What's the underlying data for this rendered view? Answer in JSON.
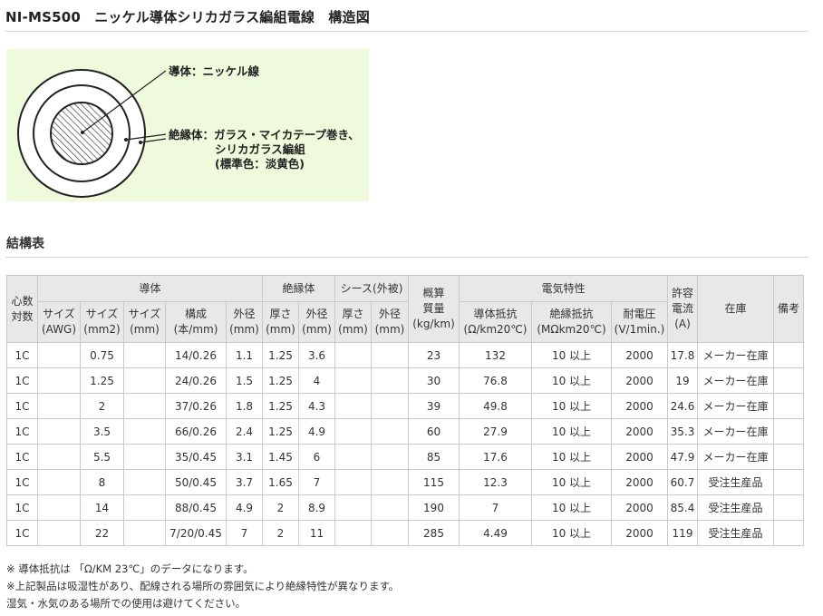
{
  "page": {
    "title": "NI-MS500　ニッケル導体シリカガラス編組電線　構造図",
    "section_title": "結構表"
  },
  "diagram": {
    "conductor_label": "導体：ニッケル線",
    "insulation_label_1": "絶縁体：ガラス・マイカテープ巻き、",
    "insulation_label_2": "シリカガラス編組",
    "insulation_label_3": "(標準色：淡黄色)"
  },
  "table": {
    "group_headers": {
      "cores": "心数\n対数",
      "conductor": "導体",
      "insulation": "絶縁体",
      "sheath": "シース(外被)",
      "mass": "概算\n質量\n(kg/km)",
      "electrical": "電気特性",
      "current": "許容\n電流\n(A)",
      "stock": "在庫",
      "remarks": "備考"
    },
    "sub_headers": {
      "awg": "サイズ\n(AWG)",
      "mm2": "サイズ\n(mm2)",
      "mm": "サイズ\n(mm)",
      "structure": "構成\n(本/mm)",
      "cond_od": "外径\n(mm)",
      "ins_thick": "厚さ\n(mm)",
      "ins_od": "外径\n(mm)",
      "sh_thick": "厚さ\n(mm)",
      "sh_od": "外径\n(mm)",
      "cond_res": "導体抵抗\n(Ω/km20℃)",
      "ins_res": "絶縁抵抗\n(MΩkm20℃)",
      "voltage": "耐電圧\n(V/1min.)"
    },
    "rows": [
      [
        "1C",
        "",
        "0.75",
        "",
        "14/0.26",
        "1.1",
        "1.25",
        "3.6",
        "",
        "",
        "23",
        "132",
        "10 以上",
        "2000",
        "17.8",
        "メーカー在庫",
        ""
      ],
      [
        "1C",
        "",
        "1.25",
        "",
        "24/0.26",
        "1.5",
        "1.25",
        "4",
        "",
        "",
        "30",
        "76.8",
        "10 以上",
        "2000",
        "19",
        "メーカー在庫",
        ""
      ],
      [
        "1C",
        "",
        "2",
        "",
        "37/0.26",
        "1.8",
        "1.25",
        "4.3",
        "",
        "",
        "39",
        "49.8",
        "10 以上",
        "2000",
        "24.6",
        "メーカー在庫",
        ""
      ],
      [
        "1C",
        "",
        "3.5",
        "",
        "66/0.26",
        "2.4",
        "1.25",
        "4.9",
        "",
        "",
        "60",
        "27.9",
        "10 以上",
        "2000",
        "35.3",
        "メーカー在庫",
        ""
      ],
      [
        "1C",
        "",
        "5.5",
        "",
        "35/0.45",
        "3.1",
        "1.45",
        "6",
        "",
        "",
        "85",
        "17.6",
        "10 以上",
        "2000",
        "47.9",
        "メーカー在庫",
        ""
      ],
      [
        "1C",
        "",
        "8",
        "",
        "50/0.45",
        "3.7",
        "1.65",
        "7",
        "",
        "",
        "115",
        "12.3",
        "10 以上",
        "2000",
        "60.7",
        "受注生産品",
        ""
      ],
      [
        "1C",
        "",
        "14",
        "",
        "88/0.45",
        "4.9",
        "2",
        "8.9",
        "",
        "",
        "190",
        "7",
        "10 以上",
        "2000",
        "85.4",
        "受注生産品",
        ""
      ],
      [
        "1C",
        "",
        "22",
        "",
        "7/20/0.45",
        "7",
        "2",
        "11",
        "",
        "",
        "285",
        "4.49",
        "10 以上",
        "2000",
        "119",
        "受注生産品",
        ""
      ]
    ]
  },
  "notes": [
    "※ 導体抵抗は 「Ω/KM 23℃」のデータになります。",
    "※上記製品は吸湿性があり、配線される場所の雰囲気により絶縁特性が異なります。",
    "湿気・水気のある場所での使用は避けてください。"
  ]
}
